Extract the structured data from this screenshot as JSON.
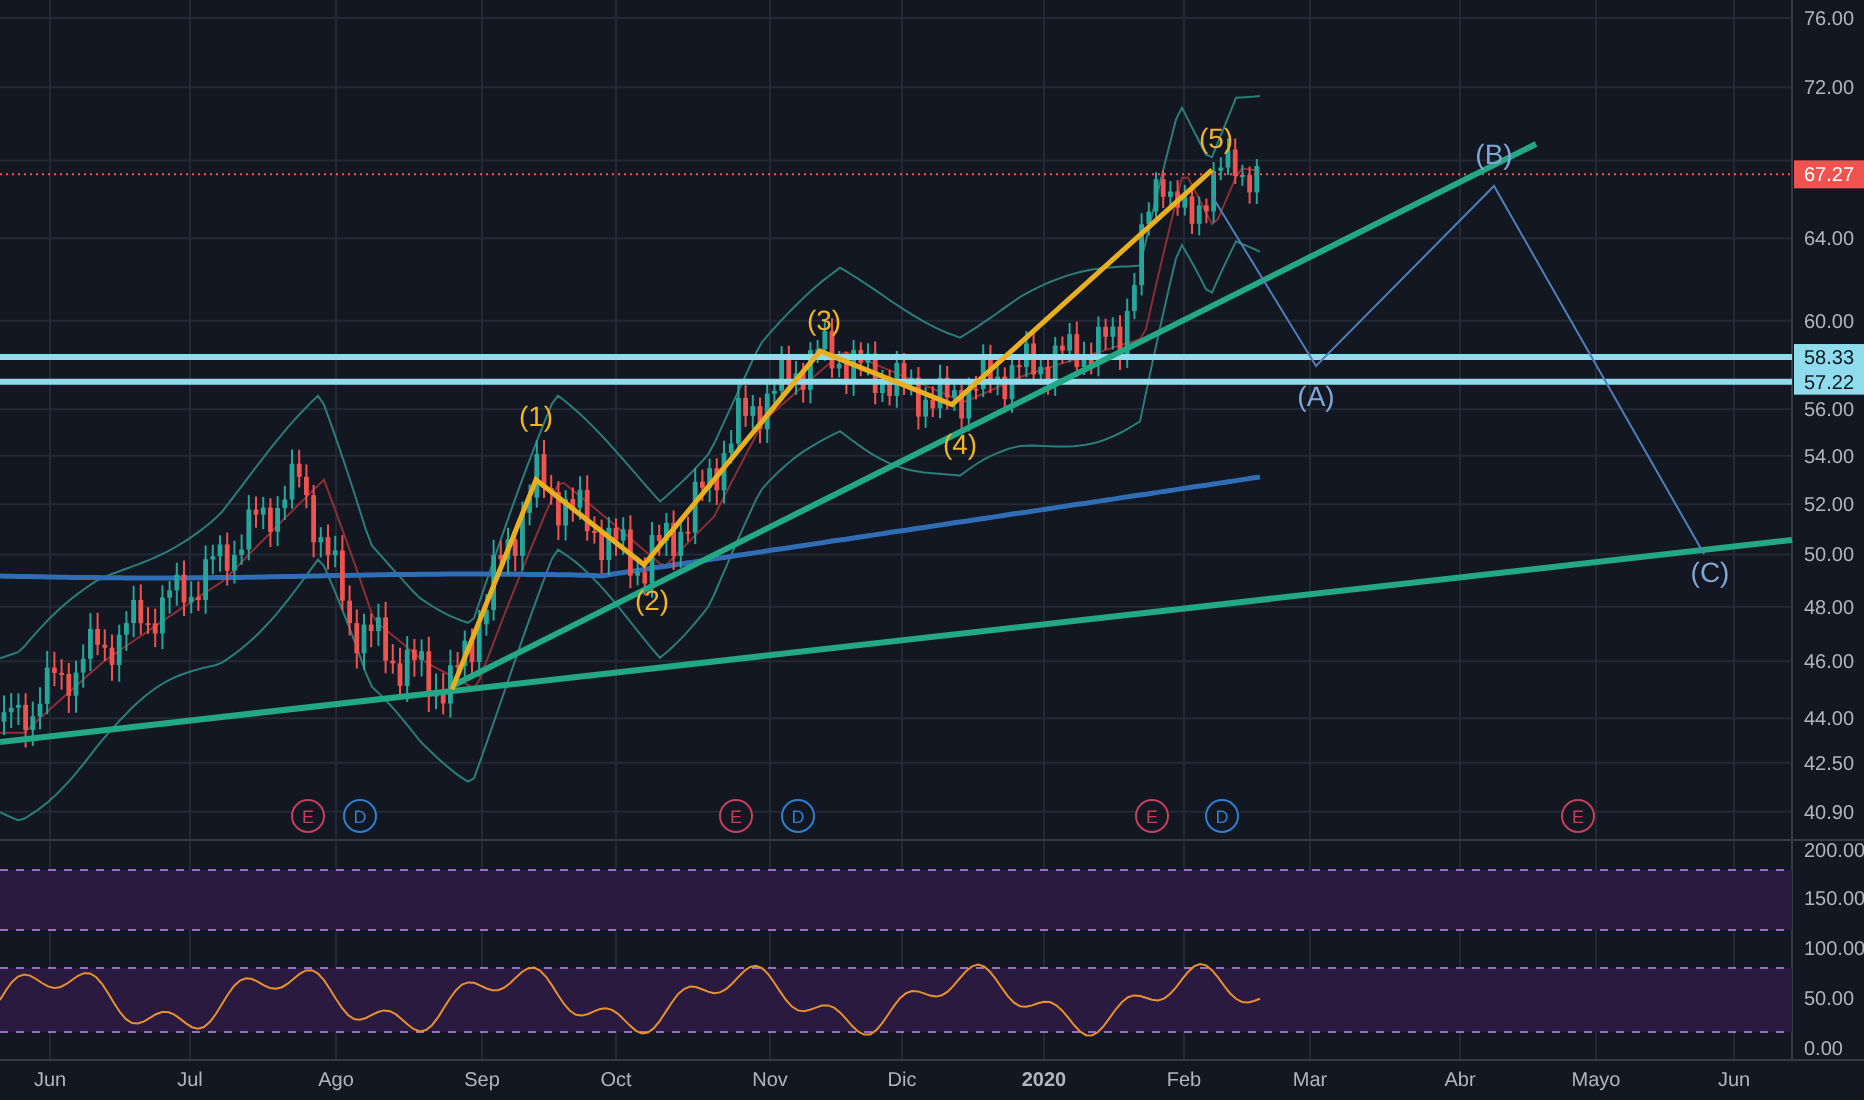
{
  "price_axis": {
    "labels": [
      "76.00",
      "72.00",
      "64.00",
      "60.00",
      "56.00",
      "54.00",
      "52.00",
      "50.00",
      "48.00",
      "46.00",
      "44.00",
      "42.50",
      "40.90"
    ]
  },
  "current_price": {
    "label": "67.27"
  },
  "levels": [
    {
      "label": "58.33"
    },
    {
      "label": "57.22"
    }
  ],
  "wave_labels": [
    {
      "label": "(1)",
      "kind": "impulse"
    },
    {
      "label": "(2)",
      "kind": "impulse"
    },
    {
      "label": "(3)",
      "kind": "impulse"
    },
    {
      "label": "(4)",
      "kind": "impulse"
    },
    {
      "label": "(5)",
      "kind": "impulse"
    },
    {
      "label": "(A)",
      "kind": "corrective"
    },
    {
      "label": "(B)",
      "kind": "corrective"
    },
    {
      "label": "(C)",
      "kind": "corrective"
    }
  ],
  "events": [
    {
      "label": "E",
      "kind": "earnings"
    },
    {
      "label": "D",
      "kind": "dividend"
    },
    {
      "label": "E",
      "kind": "earnings"
    },
    {
      "label": "D",
      "kind": "dividend"
    },
    {
      "label": "E",
      "kind": "earnings"
    },
    {
      "label": "D",
      "kind": "dividend"
    },
    {
      "label": "E",
      "kind": "earnings"
    }
  ],
  "indicator_axis": {
    "labels": [
      "200.00",
      "150.00",
      "100.00",
      "50.00",
      "0.00"
    ]
  },
  "time_axis": {
    "labels": [
      {
        "label": "Jun",
        "kind": "month"
      },
      {
        "label": "Jul",
        "kind": "month"
      },
      {
        "label": "Ago",
        "kind": "month"
      },
      {
        "label": "Sep",
        "kind": "month"
      },
      {
        "label": "Oct",
        "kind": "month"
      },
      {
        "label": "Nov",
        "kind": "month"
      },
      {
        "label": "Dic",
        "kind": "month"
      },
      {
        "label": "2020",
        "kind": "year"
      },
      {
        "label": "Feb",
        "kind": "month"
      },
      {
        "label": "Mar",
        "kind": "month"
      },
      {
        "label": "Abr",
        "kind": "month"
      },
      {
        "label": "Mayo",
        "kind": "month"
      },
      {
        "label": "Jun",
        "kind": "month"
      }
    ]
  }
}
